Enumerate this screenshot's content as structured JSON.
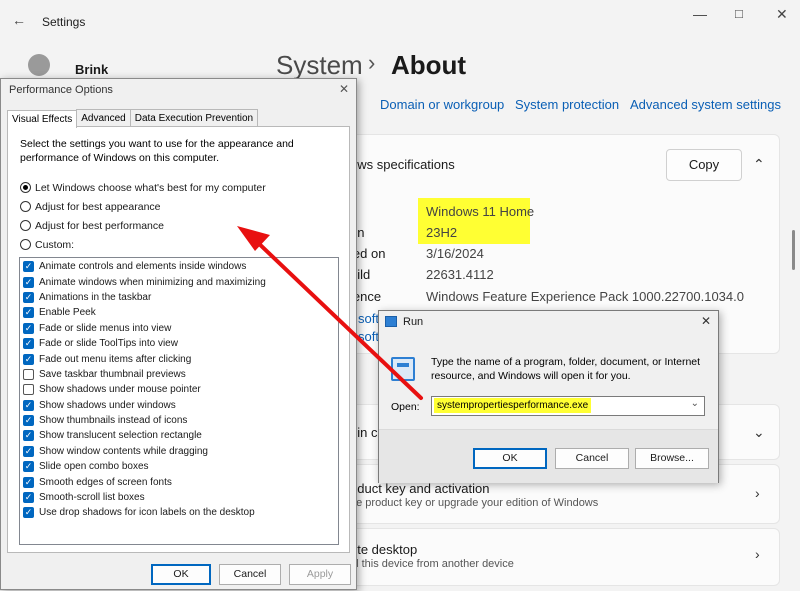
{
  "settings": {
    "title": "Settings",
    "user_name": "Brink",
    "breadcrumb": {
      "parent": "System",
      "separator": "›",
      "current": "About"
    },
    "related_links": [
      "Domain or workgroup",
      "System protection",
      "Advanced system settings"
    ],
    "windows_spec": {
      "header": "ows specifications",
      "copy_label": "Copy",
      "rows": [
        {
          "label": "n",
          "value": "Windows 11 Home"
        },
        {
          "label": "on",
          "value": "23H2"
        },
        {
          "label": "led on",
          "value": "3/16/2024"
        },
        {
          "label": "uild",
          "value": "22631.4112"
        },
        {
          "label": "ience",
          "value": "Windows Feature Experience Pack 1000.22700.1034.0"
        }
      ],
      "link_1": "soft",
      "link_2": "soft"
    },
    "rows": [
      {
        "title": "l-in c",
        "sub": ""
      },
      {
        "title": "oduct key and activation",
        "sub": "ge product key or upgrade your edition of Windows"
      },
      {
        "title": "ote desktop",
        "sub": "ol this device from another device"
      }
    ]
  },
  "perf": {
    "title": "Performance Options",
    "tabs": [
      "Visual Effects",
      "Advanced",
      "Data Execution Prevention"
    ],
    "intro": "Select the settings you want to use for the appearance and performance of Windows on this computer.",
    "radios": [
      {
        "label": "Let Windows choose what's best for my computer",
        "on": true
      },
      {
        "label": "Adjust for best appearance",
        "on": false
      },
      {
        "label": "Adjust for best performance",
        "on": false
      },
      {
        "label": "Custom:",
        "on": false
      }
    ],
    "checks": [
      {
        "label": "Animate controls and elements inside windows",
        "on": true
      },
      {
        "label": "Animate windows when minimizing and maximizing",
        "on": true
      },
      {
        "label": "Animations in the taskbar",
        "on": true
      },
      {
        "label": "Enable Peek",
        "on": true
      },
      {
        "label": "Fade or slide menus into view",
        "on": true
      },
      {
        "label": "Fade or slide ToolTips into view",
        "on": true
      },
      {
        "label": "Fade out menu items after clicking",
        "on": true
      },
      {
        "label": "Save taskbar thumbnail previews",
        "on": false
      },
      {
        "label": "Show shadows under mouse pointer",
        "on": false
      },
      {
        "label": "Show shadows under windows",
        "on": true
      },
      {
        "label": "Show thumbnails instead of icons",
        "on": true
      },
      {
        "label": "Show translucent selection rectangle",
        "on": true
      },
      {
        "label": "Show window contents while dragging",
        "on": true
      },
      {
        "label": "Slide open combo boxes",
        "on": true
      },
      {
        "label": "Smooth edges of screen fonts",
        "on": true
      },
      {
        "label": "Smooth-scroll list boxes",
        "on": true
      },
      {
        "label": "Use drop shadows for icon labels on the desktop",
        "on": true
      }
    ],
    "ok": "OK",
    "cancel": "Cancel",
    "apply": "Apply"
  },
  "run": {
    "title": "Run",
    "description": "Type the name of a program, folder, document, or Internet resource, and Windows will open it for you.",
    "open_label": "Open:",
    "open_value": "systempropertiesperformance.exe",
    "ok": "OK",
    "cancel": "Cancel",
    "browse": "Browse..."
  },
  "colors": {
    "highlight": "#ffff33",
    "arrow": "#e81010",
    "accent": "#0067c0",
    "link": "#0a5fb5"
  }
}
